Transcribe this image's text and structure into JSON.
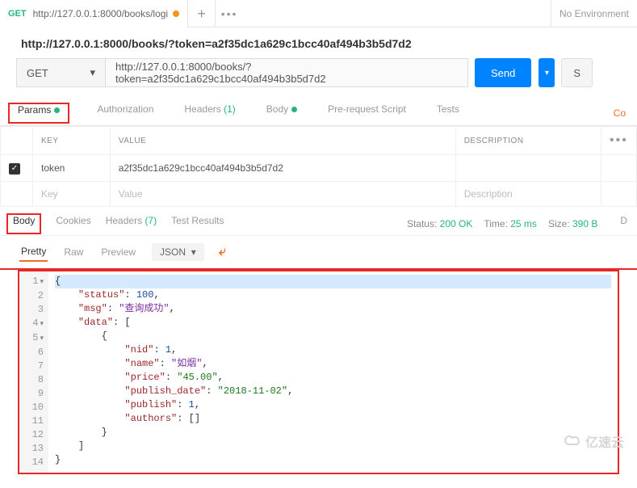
{
  "top": {
    "tab_method": "GET",
    "tab_title": "http://127.0.0.1:8000/books/logi",
    "plus": "+",
    "kebab": "•••",
    "environment": "No Environment"
  },
  "url_title": "http://127.0.0.1:8000/books/?token=a2f35dc1a629c1bcc40af494b3b5d7d2",
  "request": {
    "method": "GET",
    "url": "http://127.0.0.1:8000/books/?token=a2f35dc1a629c1bcc40af494b3b5d7d2",
    "send": "Send",
    "save": "S"
  },
  "req_tabs": {
    "params": "Params",
    "authorization": "Authorization",
    "headers": "Headers",
    "headers_count": "(1)",
    "body": "Body",
    "prereq": "Pre-request Script",
    "tests": "Tests",
    "cookies": "Co"
  },
  "params_table": {
    "head_key": "KEY",
    "head_value": "VALUE",
    "head_desc": "DESCRIPTION",
    "row_key": "token",
    "row_value": "a2f35dc1a629c1bcc40af494b3b5d7d2",
    "ph_key": "Key",
    "ph_value": "Value",
    "ph_desc": "Description"
  },
  "resp_tabs": {
    "body": "Body",
    "cookies": "Cookies",
    "headers": "Headers",
    "headers_count": "(7)",
    "tests": "Test Results"
  },
  "status": {
    "label_status": "Status:",
    "status": "200 OK",
    "label_time": "Time:",
    "time": "25 ms",
    "label_size": "Size:",
    "size": "390 B",
    "download": "D"
  },
  "view": {
    "pretty": "Pretty",
    "raw": "Raw",
    "preview": "Preview",
    "json": "JSON",
    "wrap_icon": "⤶"
  },
  "code_lines": {
    "l1": "{",
    "l2_k": "\"status\"",
    "l2_v": "100",
    "l3_k": "\"msg\"",
    "l3_v": "\"查询成功\"",
    "l4_k": "\"data\"",
    "l6_k": "\"nid\"",
    "l6_v": "1",
    "l7_k": "\"name\"",
    "l7_v": "\"如烟\"",
    "l8_k": "\"price\"",
    "l8_v": "\"45.00\"",
    "l9_k": "\"publish_date\"",
    "l9_v": "\"2018-11-02\"",
    "l10_k": "\"publish\"",
    "l10_v": "1",
    "l11_k": "\"authors\""
  },
  "watermark": "亿速云",
  "chart_data": {
    "type": "table",
    "title": "JSON response body",
    "response": {
      "status": 100,
      "msg": "查询成功",
      "data": [
        {
          "nid": 1,
          "name": "如烟",
          "price": "45.00",
          "publish_date": "2018-11-02",
          "publish": 1,
          "authors": []
        }
      ]
    }
  }
}
